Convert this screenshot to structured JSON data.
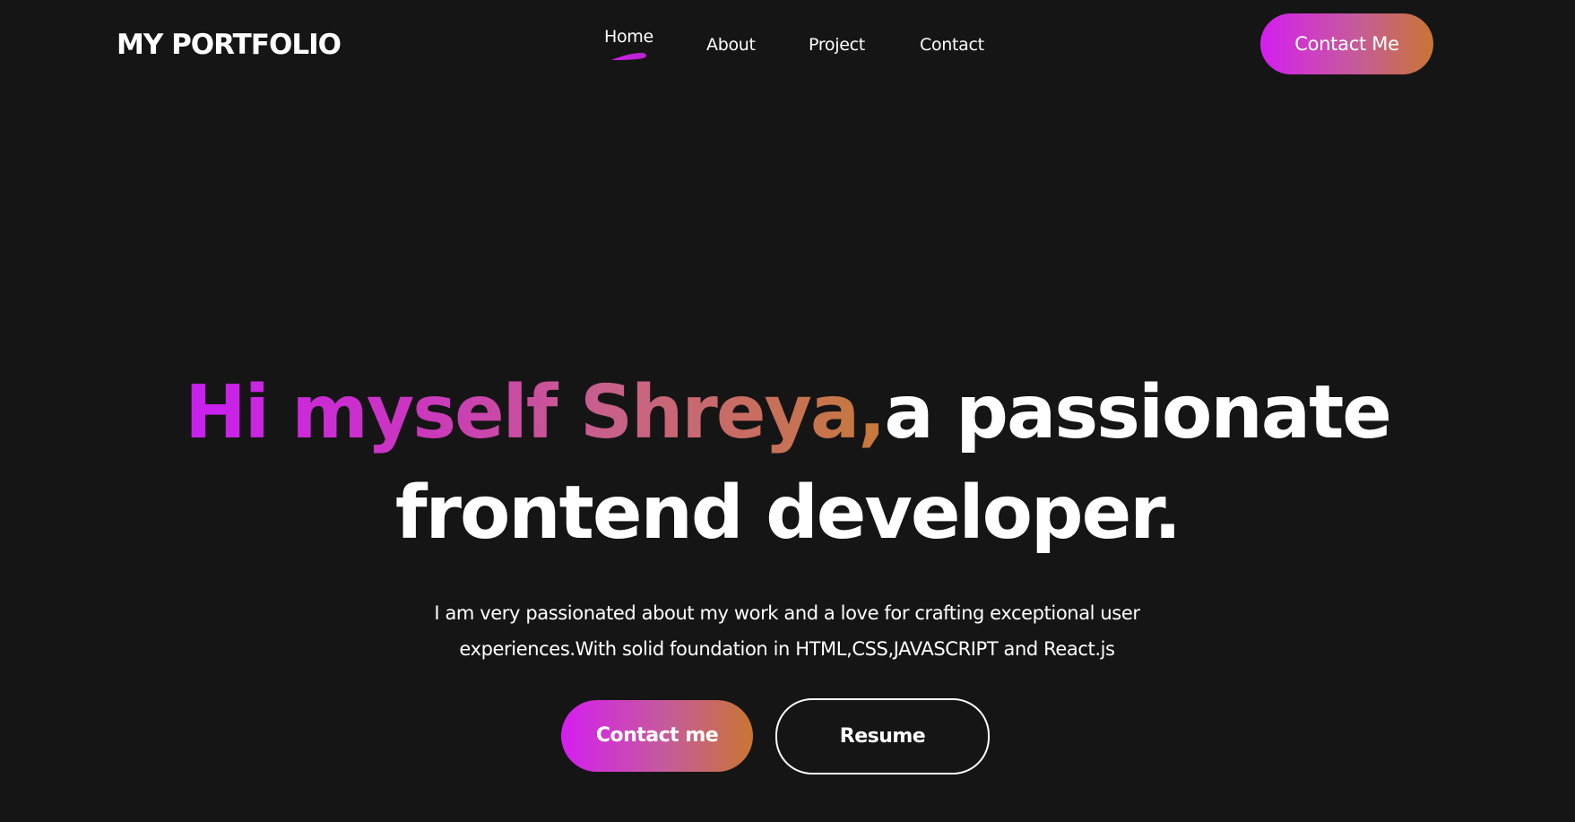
{
  "navbar": {
    "logo": "MY PORTFOLIO",
    "menu": [
      {
        "label": "Home",
        "active": true
      },
      {
        "label": "About",
        "active": false
      },
      {
        "label": "Project",
        "active": false
      },
      {
        "label": "Contact",
        "active": false
      }
    ],
    "cta_label": "Contact Me"
  },
  "hero": {
    "title_highlight": "Hi myself Shreya,",
    "title_rest_line1": "a passionate",
    "title_line2": "frontend developer.",
    "description_line1": "I am very passionated about my work and a love for crafting exceptional user",
    "description_line2": "experiences.With solid foundation in HTML,CSS,JAVASCRIPT and React.js",
    "primary_button": "Contact me",
    "secondary_button": "Resume"
  },
  "colors": {
    "background": "#161515",
    "text": "#ffffff",
    "gradient_start": "#d41ef0",
    "gradient_end": "#c97533"
  }
}
